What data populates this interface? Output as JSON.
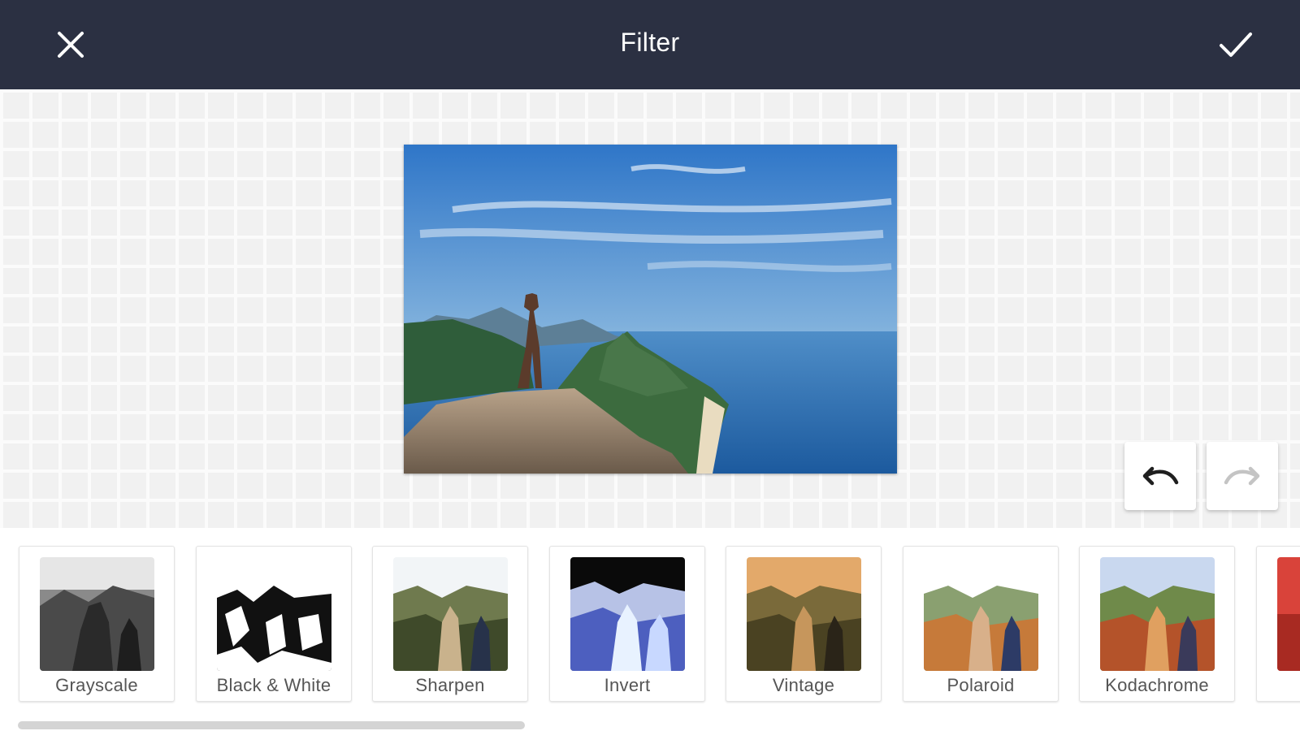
{
  "header": {
    "title": "Filter",
    "close_icon": "close-icon",
    "confirm_icon": "check-icon",
    "background": "#2b3042"
  },
  "editor": {
    "undo_icon": "undo-icon",
    "redo_icon": "redo-icon",
    "redo_enabled": false
  },
  "filters": [
    {
      "label": "Grayscale"
    },
    {
      "label": "Black & White"
    },
    {
      "label": "Sharpen"
    },
    {
      "label": "Invert"
    },
    {
      "label": "Vintage"
    },
    {
      "label": "Polaroid"
    },
    {
      "label": "Kodachrome"
    }
  ]
}
